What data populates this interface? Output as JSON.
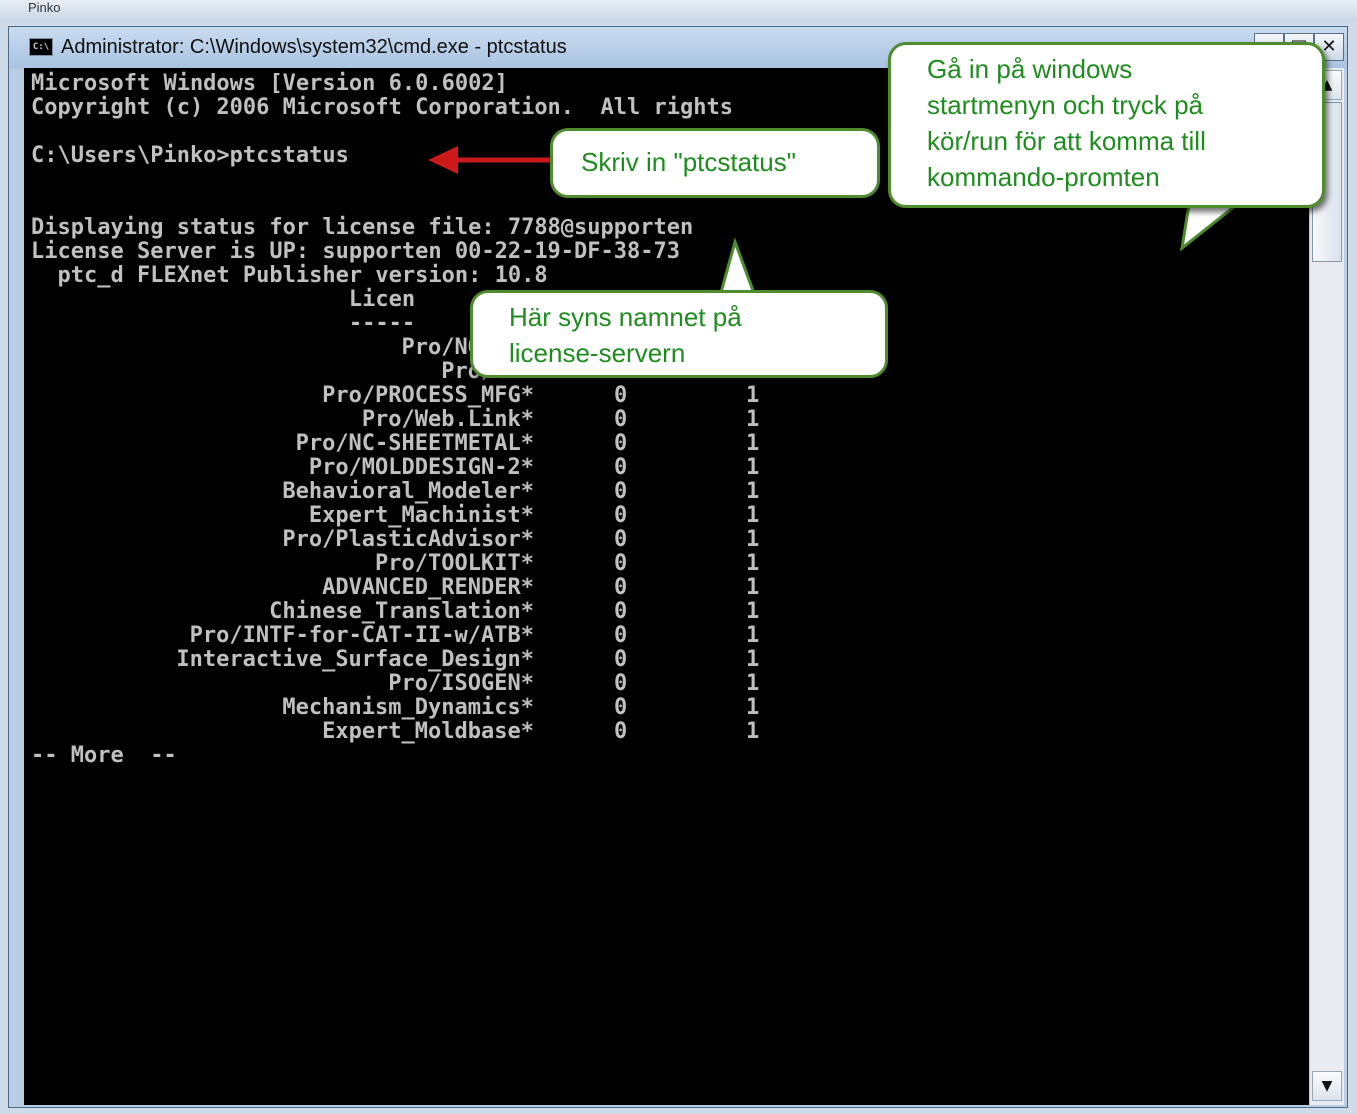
{
  "background": {
    "label": "Pinko"
  },
  "window": {
    "title": "Administrator: C:\\Windows\\system32\\cmd.exe - ptcstatus",
    "icon_text": "C:\\",
    "controls": {
      "minimize": "—",
      "maximize": "□",
      "close": "✕"
    }
  },
  "console": {
    "header": [
      "Microsoft Windows [Version 6.0.6002]",
      "Copyright (c) 2006 Microsoft Corporation.  All rights",
      "",
      "C:\\Users\\Pinko>ptcstatus",
      "",
      "",
      "Displaying status for license file: 7788@supporten",
      "License Server is UP: supporten 00-22-19-DF-38-73",
      "  ptc_d FLEXnet Publisher version: 10.8",
      "                        Licen",
      "                        -----"
    ],
    "license_rows": [
      {
        "name": "Pro/NOTEBO",
        "used": "",
        "total": ""
      },
      {
        "name": "Pro/CMM",
        "used": "",
        "total": ""
      },
      {
        "name": "Pro/PROCESS_MFG*",
        "used": "0",
        "total": "1"
      },
      {
        "name": "Pro/Web.Link*",
        "used": "0",
        "total": "1"
      },
      {
        "name": "Pro/NC-SHEETMETAL*",
        "used": "0",
        "total": "1"
      },
      {
        "name": "Pro/MOLDDESIGN-2*",
        "used": "0",
        "total": "1"
      },
      {
        "name": "Behavioral_Modeler*",
        "used": "0",
        "total": "1"
      },
      {
        "name": "Expert_Machinist*",
        "used": "0",
        "total": "1"
      },
      {
        "name": "Pro/PlasticAdvisor*",
        "used": "0",
        "total": "1"
      },
      {
        "name": "Pro/TOOLKIT*",
        "used": "0",
        "total": "1"
      },
      {
        "name": "ADVANCED_RENDER*",
        "used": "0",
        "total": "1"
      },
      {
        "name": "Chinese_Translation*",
        "used": "0",
        "total": "1"
      },
      {
        "name": "Pro/INTF-for-CAT-II-w/ATB*",
        "used": "0",
        "total": "1"
      },
      {
        "name": "Interactive_Surface_Design*",
        "used": "0",
        "total": "1"
      },
      {
        "name": "Pro/ISOGEN*",
        "used": "0",
        "total": "1"
      },
      {
        "name": "Mechanism_Dynamics*",
        "used": "0",
        "total": "1"
      },
      {
        "name": "Expert_Moldbase*",
        "used": "0",
        "total": "1"
      }
    ],
    "more_prompt": "-- More  --"
  },
  "callouts": {
    "type_command": "Skriv in \"ptcstatus\"",
    "server_name": [
      "Här syns namnet på",
      "license-servern"
    ],
    "start_menu": [
      "Gå in på windows",
      "startmenyn och tryck på",
      "kör/run för att komma till",
      "kommando-promten"
    ]
  },
  "scrollbar": {
    "up_arrow": "▲",
    "down_arrow": "▼"
  },
  "colors": {
    "console_bg": "#000000",
    "console_text": "#c0c0c0",
    "callout_text": "#1e8c1e",
    "callout_border": "#4e8c2e",
    "arrow": "#cc1a1a"
  }
}
